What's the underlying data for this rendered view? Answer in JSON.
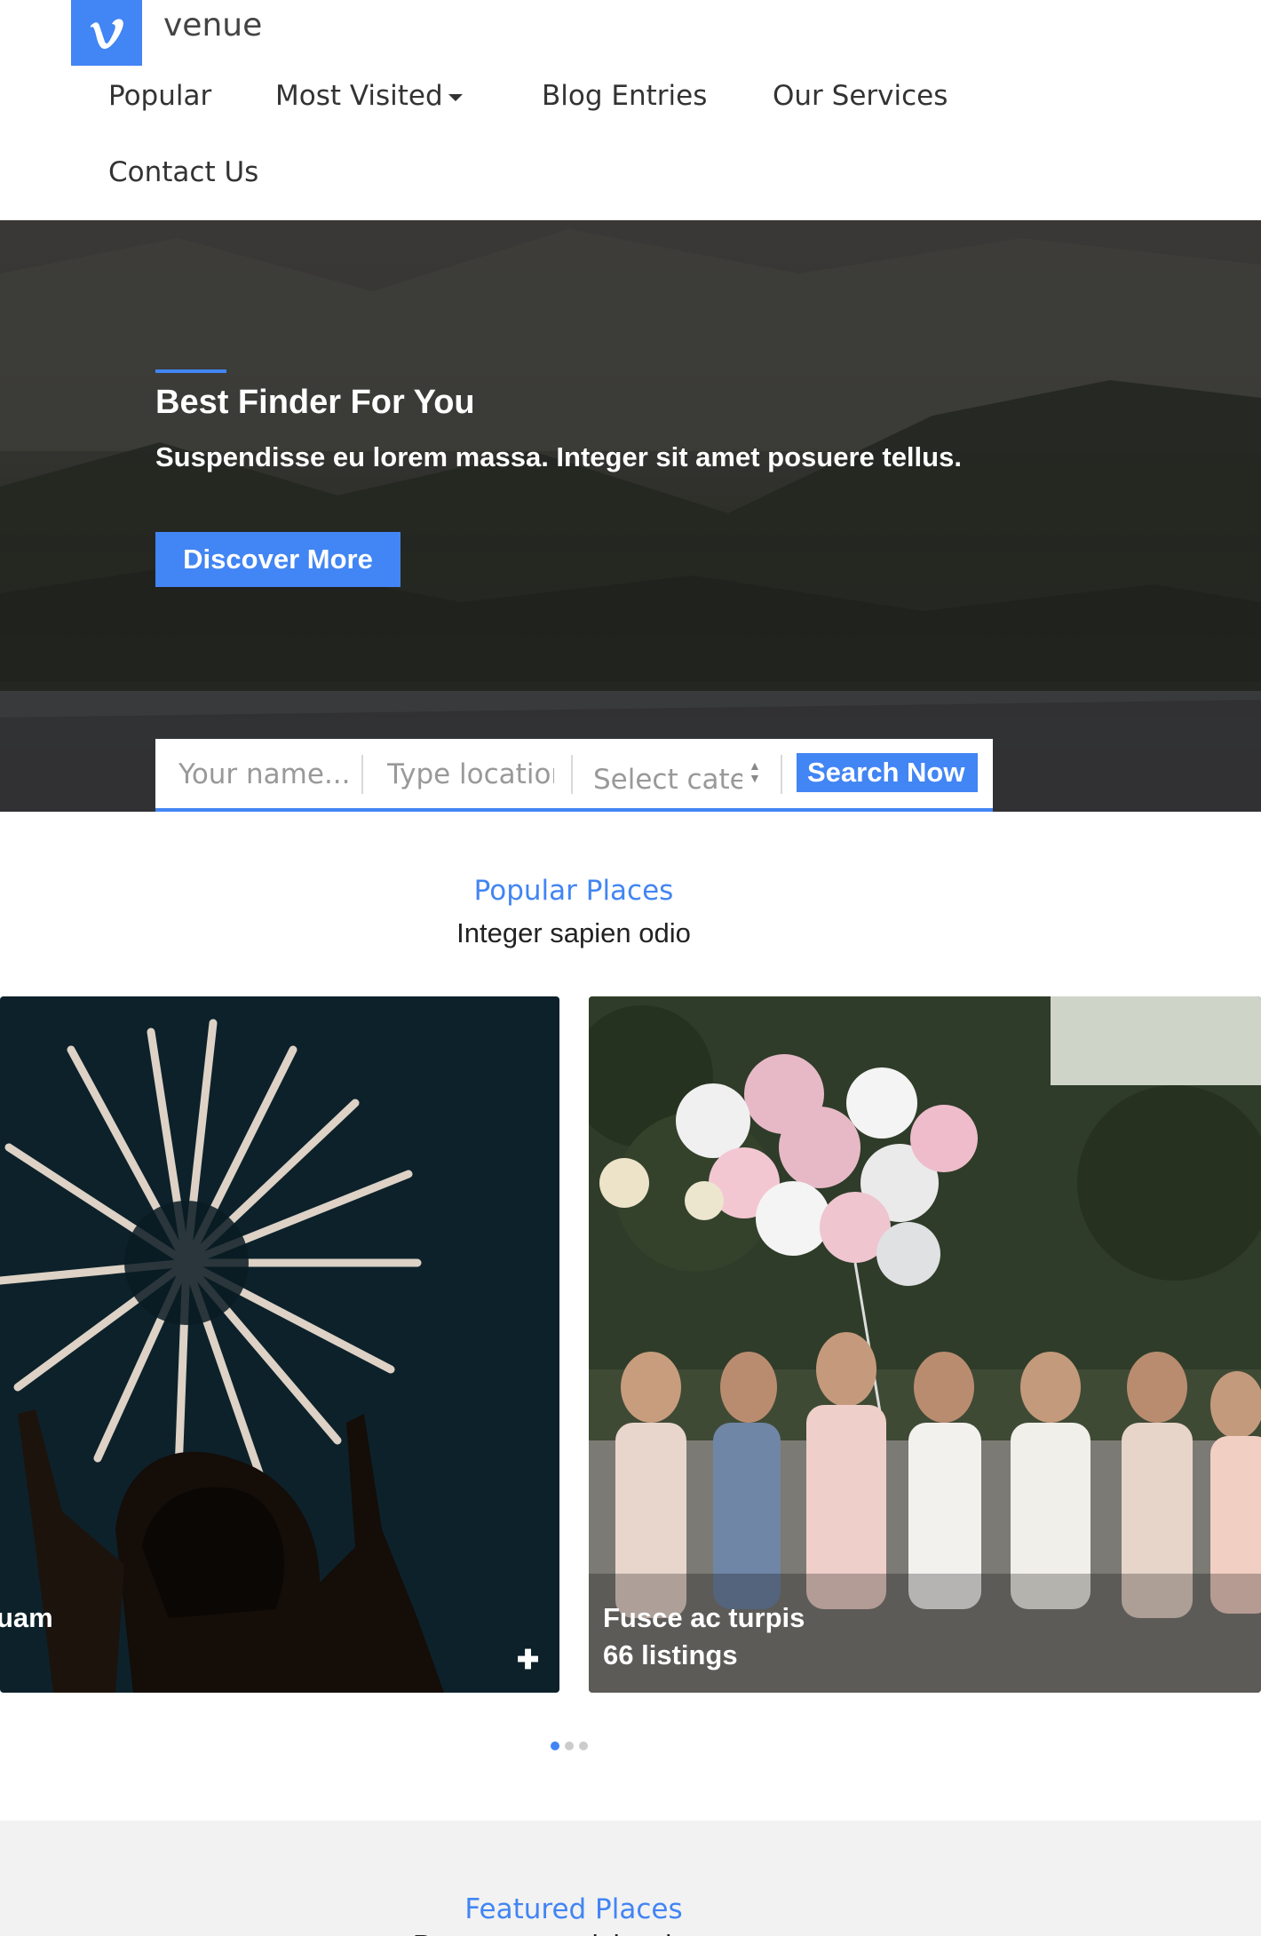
{
  "brand": {
    "name": "venue",
    "logo_letter": "v",
    "accent": "#4285f4"
  },
  "nav": {
    "items": [
      {
        "label": "Popular"
      },
      {
        "label": "Most Visited",
        "has_dropdown": true
      },
      {
        "label": "Blog Entries"
      },
      {
        "label": "Our Services"
      },
      {
        "label": "Contact Us"
      }
    ]
  },
  "hero": {
    "title": "Best Finder For You",
    "subtitle": "Suspendisse eu lorem massa. Integer sit amet posuere tellus.",
    "button": "Discover More"
  },
  "search": {
    "name_placeholder": "Your name...",
    "location_placeholder": "Type location...",
    "category_placeholder": "Select category",
    "button": "Search Now"
  },
  "popular": {
    "label": "Popular Places",
    "subtitle": "Integer sapien odio",
    "cards": [
      {
        "title_fragment": "uam",
        "icon": "plus-icon"
      },
      {
        "title": "Fusce ac turpis",
        "count": "66 listings"
      }
    ],
    "carousel_dots": 3,
    "active_dot": 0
  },
  "featured": {
    "label": "Featured Places",
    "subtitle": "Praesent nec dui sed urna"
  }
}
